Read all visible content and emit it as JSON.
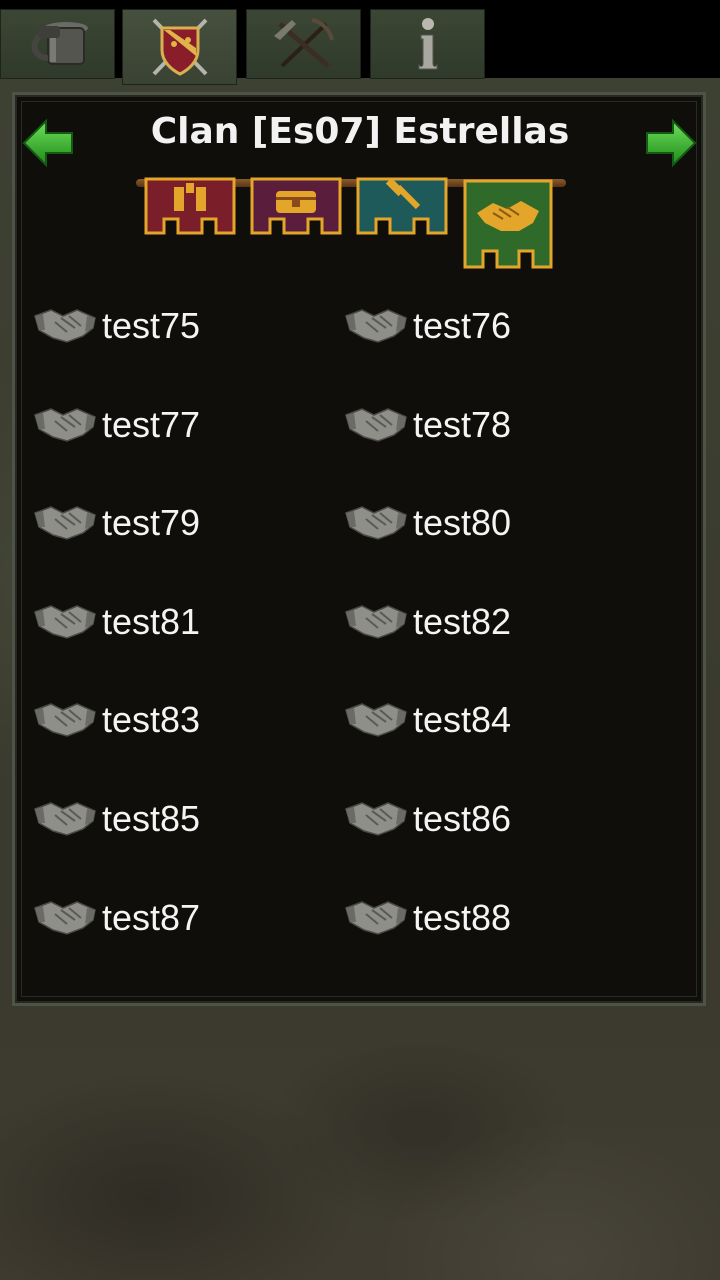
{
  "tabs": [
    {
      "id": "tavern",
      "icon": "tankard-icon"
    },
    {
      "id": "clan",
      "icon": "shield-swords-icon",
      "active": true
    },
    {
      "id": "weapons",
      "icon": "crossbow-pickaxe-icon"
    },
    {
      "id": "info",
      "icon": "info-icon"
    }
  ],
  "clan": {
    "title": "Clan [Es07] Estrellas"
  },
  "banners": [
    {
      "id": "members",
      "icon": "members-banner-icon",
      "color": "#7a1f2a"
    },
    {
      "id": "treasury",
      "icon": "chest-banner-icon",
      "color": "#5a1d3c"
    },
    {
      "id": "buildings",
      "icon": "hammer-banner-icon",
      "color": "#1f5a5a"
    },
    {
      "id": "alliances",
      "icon": "handshake-banner-icon",
      "color": "#2f6a2a",
      "selected": true
    }
  ],
  "members": [
    "test75",
    "test76",
    "test77",
    "test78",
    "test79",
    "test80",
    "test81",
    "test82",
    "test83",
    "test84",
    "test85",
    "test86",
    "test87",
    "test88"
  ],
  "colors": {
    "panel_bg": "#0f0e0a",
    "text": "#f4f4f4",
    "arrow_green": "#3fbf2f",
    "banner_gold": "#e3a62a"
  }
}
